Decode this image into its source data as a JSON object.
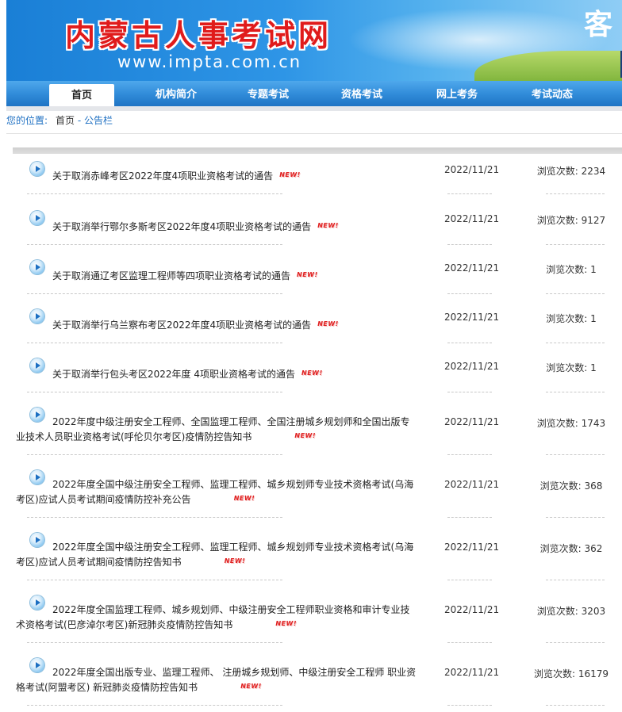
{
  "header": {
    "site_title": "内蒙古人事考试网",
    "site_url": "www.impta.com.cn",
    "corner_text": "客"
  },
  "nav": {
    "items": [
      {
        "label": "首页",
        "active": true
      },
      {
        "label": "机构简介"
      },
      {
        "label": "专题考试"
      },
      {
        "label": "资格考试"
      },
      {
        "label": "网上考务"
      },
      {
        "label": "考试动态"
      }
    ]
  },
  "breadcrumb": {
    "label": "您的位置:",
    "home": "首页",
    "separator": " - ",
    "current": "公告栏"
  },
  "notices": [
    {
      "title": "关于取消赤峰考区2022年度4项职业资格考试的通告",
      "badge": "NEW!",
      "date": "2022/11/21",
      "views": "浏览次数: 2234"
    },
    {
      "title": "关于取消举行鄂尔多斯考区2022年度4项职业资格考试的通告",
      "badge": "NEW!",
      "date": "2022/11/21",
      "views": "浏览次数: 9127"
    },
    {
      "title": "关于取消通辽考区监理工程师等四项职业资格考试的通告",
      "badge": "NEW!",
      "date": "2022/11/21",
      "views": "浏览次数: 1"
    },
    {
      "title": "关于取消举行乌兰察布考区2022年度4项职业资格考试的通告",
      "badge": "NEW!",
      "date": "2022/11/21",
      "views": "浏览次数: 1"
    },
    {
      "title": "关于取消举行包头考区2022年度 4项职业资格考试的通告",
      "badge": "NEW!",
      "date": "2022/11/21",
      "views": "浏览次数: 1"
    },
    {
      "title": "2022年度中级注册安全工程师、全国监理工程师、全国注册城乡规划师和全国出版专业技术人员职业资格考试(呼伦贝尔考区)疫情防控告知书",
      "badge": "NEW!",
      "date": "2022/11/21",
      "views": "浏览次数: 1743"
    },
    {
      "title": "2022年度全国中级注册安全工程师、监理工程师、城乡规划师专业技术资格考试(乌海考区)应试人员考试期间疫情防控补充公告",
      "badge": "NEW!",
      "date": "2022/11/21",
      "views": "浏览次数: 368"
    },
    {
      "title": "2022年度全国中级注册安全工程师、监理工程师、城乡规划师专业技术资格考试(乌海考区)应试人员考试期间疫情防控告知书",
      "badge": "NEW!",
      "date": "2022/11/21",
      "views": "浏览次数: 362"
    },
    {
      "title": "2022年度全国监理工程师、城乡规划师、中级注册安全工程师职业资格和审计专业技术资格考试(巴彦淖尔考区)新冠肺炎疫情防控告知书",
      "badge": "NEW!",
      "date": "2022/11/21",
      "views": "浏览次数: 3203"
    },
    {
      "title": "2022年度全国出版专业、监理工程师、 注册城乡规划师、中级注册安全工程师 职业资格考试(阿盟考区) 新冠肺炎疫情防控告知书",
      "badge": "NEW!",
      "date": "2022/11/21",
      "views": "浏览次数: 16179"
    }
  ]
}
